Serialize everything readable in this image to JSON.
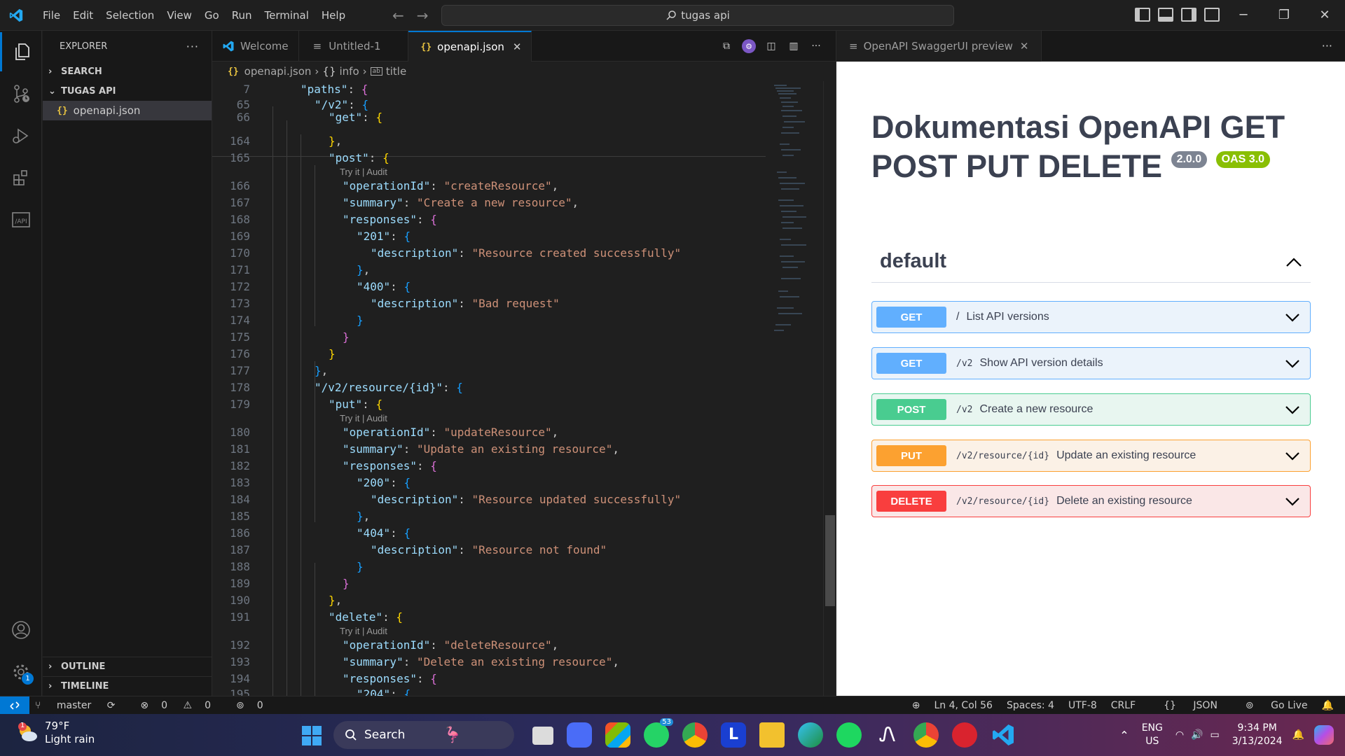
{
  "menu": [
    "File",
    "Edit",
    "Selection",
    "View",
    "Go",
    "Run",
    "Terminal",
    "Help"
  ],
  "command_center": "tugas api",
  "sidebar": {
    "title": "EXPLORER",
    "search_section": "SEARCH",
    "folder": "TUGAS API",
    "file": "openapi.json",
    "outline": "OUTLINE",
    "timeline": "TIMELINE",
    "accounts_badge": "1"
  },
  "tabs": [
    {
      "label": "Welcome"
    },
    {
      "label": "Untitled-1"
    },
    {
      "label": "openapi.json"
    }
  ],
  "breadcrumb": [
    "openapi.json",
    "info",
    "title"
  ],
  "code_lens": "Try it | Audit",
  "preview_tab": "OpenAPI SwaggerUI preview",
  "swagger": {
    "title": "Dokumentasi OpenAPI GET POST PUT DELETE",
    "version": "2.0.0",
    "oas": "OAS 3.0",
    "tag": "default",
    "operations": [
      {
        "method": "GET",
        "path": "/",
        "summary": "List API versions",
        "color": "#61affe",
        "bg": "#ebf3fb"
      },
      {
        "method": "GET",
        "path": "/v2",
        "summary": "Show API version details",
        "color": "#61affe",
        "bg": "#ebf3fb"
      },
      {
        "method": "POST",
        "path": "/v2",
        "summary": "Create a new resource",
        "color": "#49cc90",
        "bg": "#e8f6f0"
      },
      {
        "method": "PUT",
        "path": "/v2/resource/{id}",
        "summary": "Update an existing resource",
        "color": "#fca130",
        "bg": "#fbf1e6"
      },
      {
        "method": "DELETE",
        "path": "/v2/resource/{id}",
        "summary": "Delete an existing resource",
        "color": "#f93e3e",
        "bg": "#fae7e7"
      }
    ]
  },
  "statusbar": {
    "branch": "master",
    "errors": "0",
    "warnings": "0",
    "ports": "0",
    "position": "Ln 4, Col 56",
    "spaces": "Spaces: 4",
    "encoding": "UTF-8",
    "eol": "CRLF",
    "language": "JSON",
    "golive": "Go Live"
  },
  "taskbar": {
    "temperature": "79°F",
    "condition": "Light rain",
    "weather_badge": "1",
    "search": "Search",
    "whatsapp_count": "53",
    "lang": "ENG",
    "region": "US",
    "time": "9:34 PM",
    "date": "3/13/2024"
  }
}
